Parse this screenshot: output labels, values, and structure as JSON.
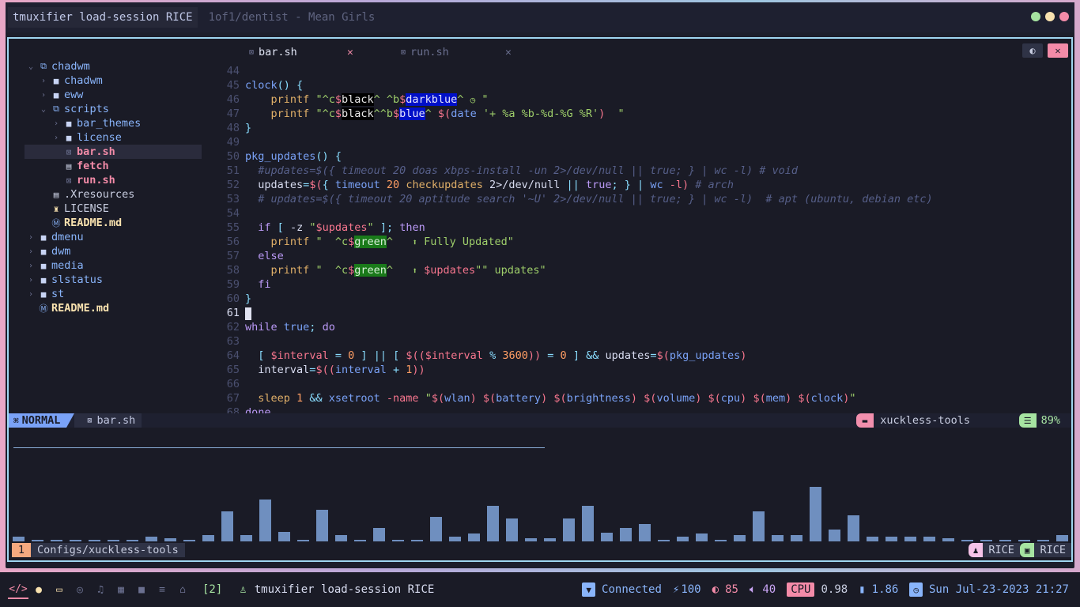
{
  "titlebar": {
    "active_title": "tmuxifier load-session RICE",
    "inactive_title": "1of1/dentist - Mean Girls",
    "dot_colors": [
      "#a6e3a1",
      "#f9e2af",
      "#f38ba8"
    ]
  },
  "tree": {
    "items": [
      {
        "label": "chadwm",
        "type": "folder-open",
        "depth": 1,
        "color": "#89b4fa",
        "expanded": true
      },
      {
        "label": "chadwm",
        "type": "folder",
        "depth": 2,
        "color": "#89b4fa"
      },
      {
        "label": "eww",
        "type": "folder",
        "depth": 2,
        "color": "#89b4fa"
      },
      {
        "label": "scripts",
        "type": "folder-open",
        "depth": 2,
        "color": "#89b4fa",
        "expanded": true
      },
      {
        "label": "bar_themes",
        "type": "folder",
        "depth": 3,
        "color": "#89b4fa"
      },
      {
        "label": "license",
        "type": "folder",
        "depth": 3,
        "color": "#89b4fa"
      },
      {
        "label": "bar.sh",
        "type": "sh-file",
        "depth": 3,
        "color": "#f38ba8",
        "selected": true
      },
      {
        "label": "fetch",
        "type": "file",
        "depth": 3,
        "color": "#f38ba8"
      },
      {
        "label": "run.sh",
        "type": "sh-file",
        "depth": 3,
        "color": "#f38ba8"
      },
      {
        "label": ".Xresources",
        "type": "file",
        "depth": 2,
        "color": "#c8cde0"
      },
      {
        "label": "LICENSE",
        "type": "license-file",
        "depth": 2,
        "color": "#c8cde0"
      },
      {
        "label": "README.md",
        "type": "md-file",
        "depth": 2,
        "color": "#f9e2af"
      },
      {
        "label": "dmenu",
        "type": "folder",
        "depth": 1,
        "color": "#89b4fa"
      },
      {
        "label": "dwm",
        "type": "folder",
        "depth": 1,
        "color": "#89b4fa"
      },
      {
        "label": "media",
        "type": "folder",
        "depth": 1,
        "color": "#89b4fa"
      },
      {
        "label": "slstatus",
        "type": "folder",
        "depth": 1,
        "color": "#89b4fa"
      },
      {
        "label": "st",
        "type": "folder",
        "depth": 1,
        "color": "#89b4fa"
      },
      {
        "label": "README.md",
        "type": "md-file",
        "depth": 1,
        "color": "#f9e2af"
      }
    ]
  },
  "tabs": [
    {
      "label": "bar.sh",
      "active": true
    },
    {
      "label": "run.sh",
      "active": false
    }
  ],
  "code": {
    "line_numbers": [
      "44",
      "45",
      "46",
      "47",
      "48",
      "49",
      "50",
      "51",
      "52",
      "53",
      "54",
      "55",
      "56",
      "57",
      "58",
      "59",
      "60",
      "61",
      "62",
      "63",
      "64",
      "65",
      "66",
      "67",
      "68"
    ],
    "current_line": "61"
  },
  "statusline": {
    "mode": "NORMAL",
    "file": "bar.sh",
    "session": "xuckless-tools",
    "percent": "89%"
  },
  "cava": {
    "color": "#6f8fbf",
    "levels": [
      6,
      2,
      2,
      2,
      2,
      2,
      2,
      6,
      4,
      2,
      8,
      38,
      8,
      53,
      12,
      2,
      40,
      8,
      2,
      17,
      2,
      2,
      31,
      6,
      10,
      45,
      29,
      4,
      4,
      29,
      45,
      11,
      17,
      22,
      2,
      6,
      10,
      2,
      8,
      38,
      8,
      8,
      69,
      15,
      33,
      6,
      6,
      6,
      6,
      4,
      2,
      2,
      2,
      2,
      2,
      8
    ]
  },
  "tmux": {
    "window_number": "1",
    "window_name": "Configs/xuckless-tools",
    "right_segments": [
      {
        "label": "RICE",
        "pill_color": "#f5c2e7",
        "icon": "person-icon"
      },
      {
        "label": "RICE",
        "pill_color": "#a6e3a1",
        "icon": "terminal-icon"
      }
    ]
  },
  "sysbar": {
    "workspaces": [
      "code-icon",
      "globe-icon",
      "monitor-icon",
      "gamepad-icon",
      "music-icon",
      "film-icon",
      "camera-icon",
      "server-icon",
      "home-icon"
    ],
    "workspace_count": "[2]",
    "window_title": "tmuxifier load-session RICE",
    "wifi": "Connected",
    "battery": "100",
    "brightness": "85",
    "volume": "40",
    "cpu_label": "CPU",
    "cpu": "0.98",
    "mem": "1.86",
    "clock": "Sun Jul-23-2023 21:27"
  }
}
